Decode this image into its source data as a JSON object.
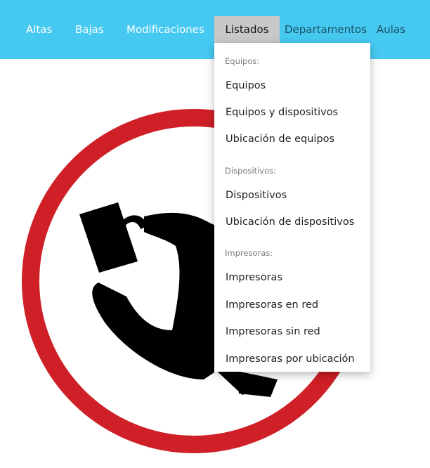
{
  "navbar": {
    "items": [
      {
        "label": "Altas"
      },
      {
        "label": "Bajas"
      },
      {
        "label": "Modificaciones"
      },
      {
        "label": "Listados"
      },
      {
        "label": "Departamentos"
      },
      {
        "label": "Aulas"
      }
    ],
    "active_item": "Listados",
    "background_color": "#46c9f1"
  },
  "listados_menu": {
    "sections": [
      {
        "header": "Equipos:",
        "items": [
          {
            "label": "Equipos"
          },
          {
            "label": "Equipos y dispositivos"
          },
          {
            "label": "Ubicación de equipos"
          }
        ]
      },
      {
        "header": "Dispositivos:",
        "items": [
          {
            "label": "Dispositivos"
          },
          {
            "label": "Ubicación de dispositivos"
          }
        ]
      },
      {
        "header": "Impresoras:",
        "items": [
          {
            "label": "Impresoras"
          },
          {
            "label": "Impresoras en red"
          },
          {
            "label": "Impresoras sin red"
          },
          {
            "label": "Impresoras por ubicación"
          }
        ]
      }
    ]
  },
  "hero": {
    "icon": "prohibition-sign-icon",
    "ring_color": "#d22027",
    "figure_color": "#000000"
  }
}
